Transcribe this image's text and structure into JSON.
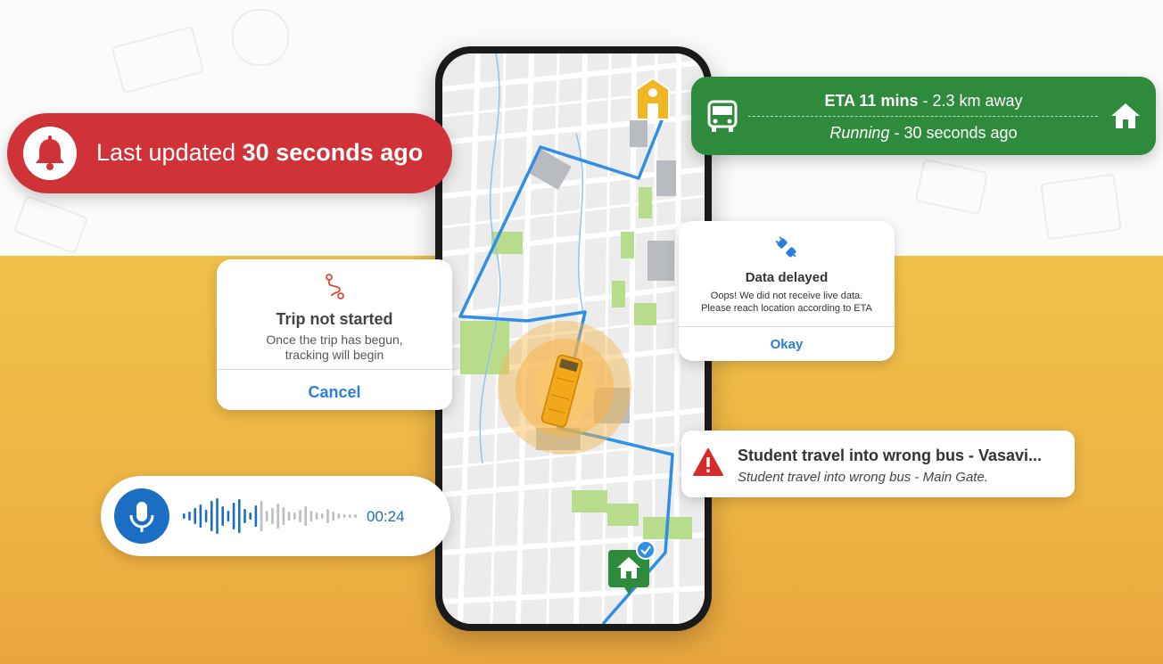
{
  "alert_banner": {
    "prefix": "Last updated",
    "highlight": "30 seconds ago",
    "icon": "bell-icon"
  },
  "eta_card": {
    "eta_label": "ETA 11 mins",
    "distance": "- 2.3 km away",
    "status": "Running",
    "status_time": "- 30 seconds ago",
    "left_icon": "bus-icon",
    "right_icon": "home-icon"
  },
  "trip_dialog": {
    "icon": "route-icon",
    "title": "Trip not started",
    "line1": "Once the trip has begun,",
    "line2": "tracking will begin",
    "button": "Cancel"
  },
  "delay_dialog": {
    "icon": "plug-icon",
    "title": "Data delayed",
    "line1": "Oops! We did not receive live data.",
    "line2": "Please reach location according  to ETA",
    "button": "Okay"
  },
  "wrong_bus": {
    "icon": "warning-icon",
    "title": "Student travel into wrong bus - Vasavi...",
    "subtitle": "Student travel into wrong bus - Main Gate."
  },
  "voice_note": {
    "icon": "microphone-icon",
    "duration": "00:24",
    "progress": 0.45
  },
  "map": {
    "school_icon": "school-icon",
    "home_icon": "home-icon",
    "bus_icon": "bus-icon",
    "route_color": "#2f8fe6",
    "accent_colors": {
      "red": "#cf3237",
      "green": "#2e8b3b",
      "blue": "#1a6fc4",
      "yellow": "#f0b722"
    }
  }
}
